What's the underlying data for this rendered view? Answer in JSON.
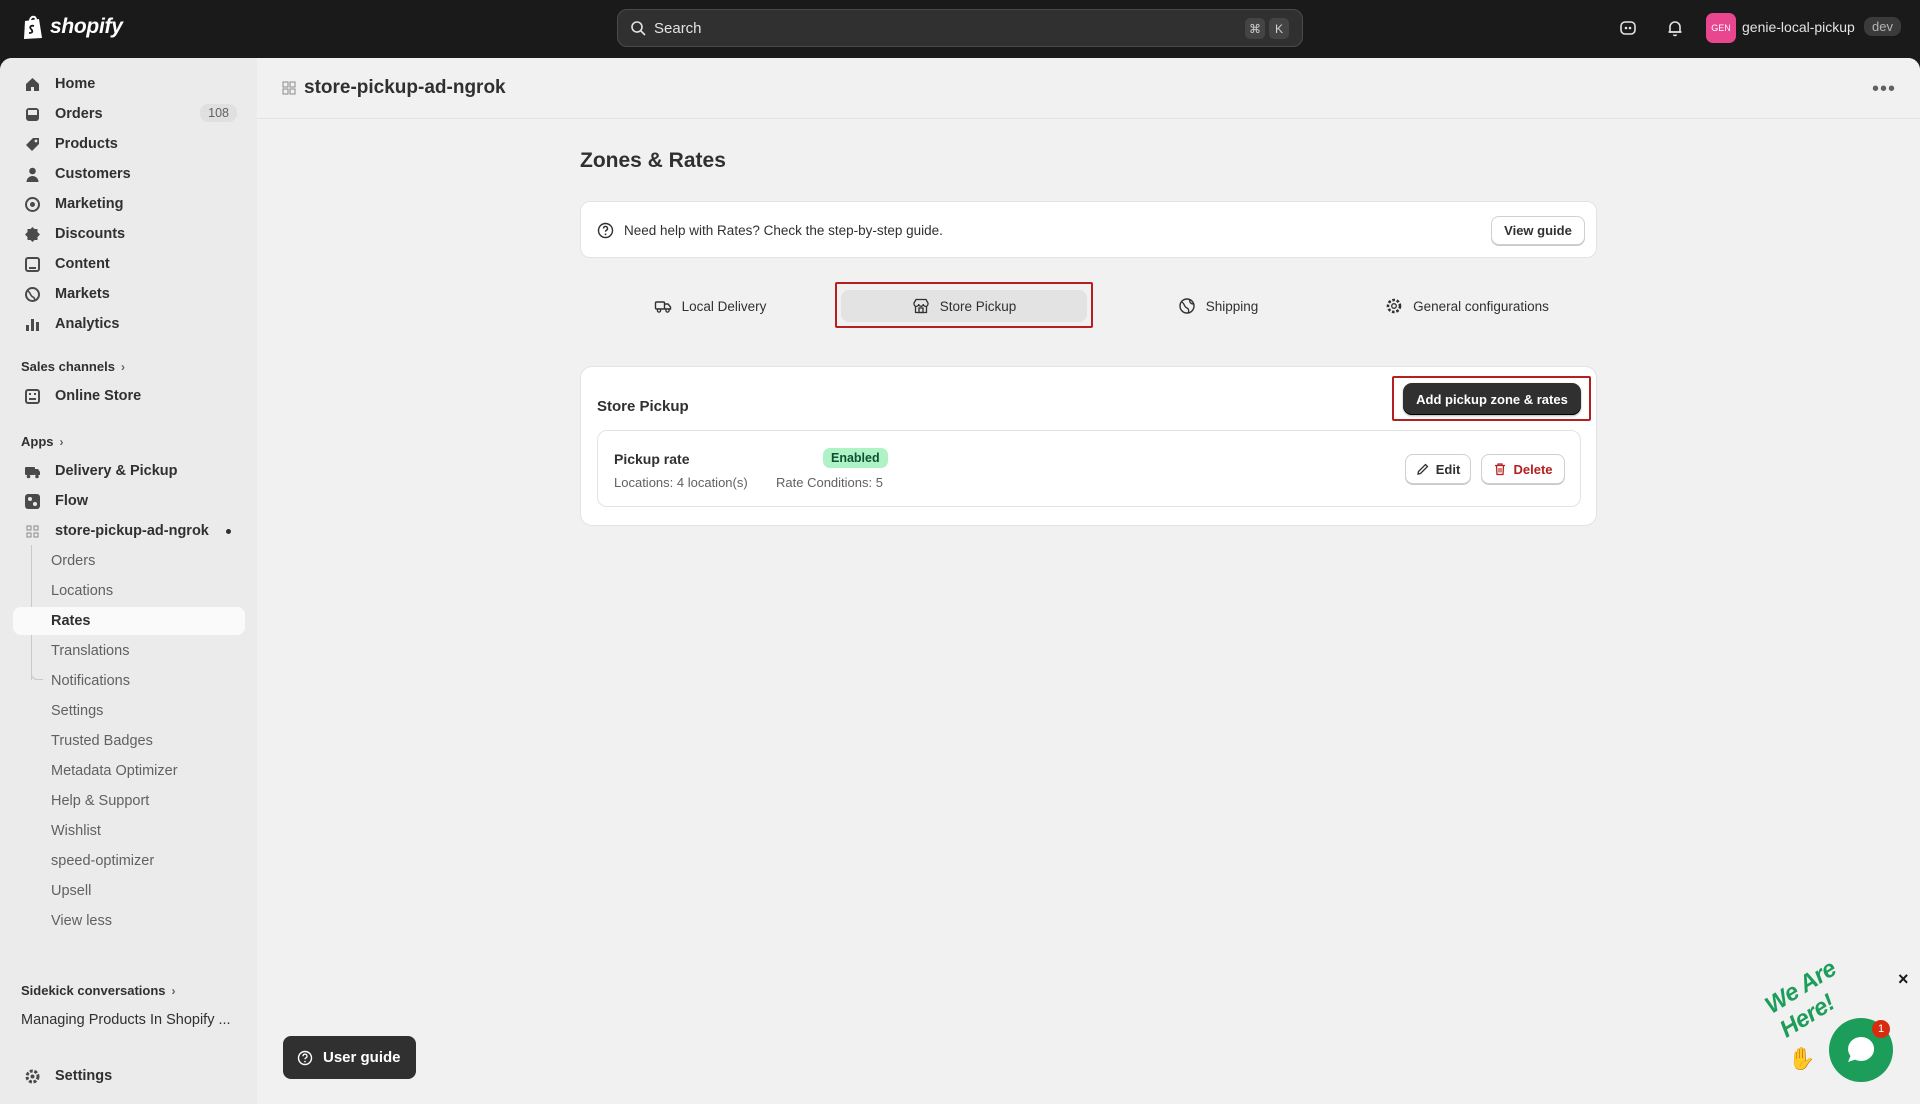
{
  "topbar": {
    "brand": "shopify",
    "search_placeholder": "Search",
    "shortcut_key1": "⌘",
    "shortcut_key2": "K",
    "store_initials": "GEN",
    "store_name": "genie-local-pickup",
    "store_tag": "dev"
  },
  "sidebar": {
    "main": [
      {
        "label": "Home"
      },
      {
        "label": "Orders",
        "count": "108"
      },
      {
        "label": "Products"
      },
      {
        "label": "Customers"
      },
      {
        "label": "Marketing"
      },
      {
        "label": "Discounts"
      },
      {
        "label": "Content"
      },
      {
        "label": "Markets"
      },
      {
        "label": "Analytics"
      }
    ],
    "sales_channels_heading": "Sales channels",
    "online_store": "Online Store",
    "apps_heading": "Apps",
    "apps": [
      "Delivery & Pickup",
      "Flow",
      "store-pickup-ad-ngrok"
    ],
    "app_sub": [
      "Orders",
      "Locations",
      "Rates",
      "Translations",
      "Notifications",
      "Settings",
      "Trusted Badges",
      "Metadata Optimizer",
      "Help & Support",
      "Wishlist",
      "speed-optimizer",
      "Upsell",
      "View less"
    ],
    "sidekick_heading": "Sidekick conversations",
    "sidekick_item": "Managing Products In Shopify ...",
    "settings": "Settings"
  },
  "page": {
    "app_title": "store-pickup-ad-ngrok",
    "heading": "Zones & Rates",
    "help_text": "Need help with Rates? Check the step-by-step guide.",
    "view_guide": "View guide",
    "tabs": [
      "Local Delivery",
      "Store Pickup",
      "Shipping",
      "General configurations"
    ],
    "selected_tab": "Store Pickup"
  },
  "store_pickup": {
    "title": "Store Pickup",
    "add_button": "Add pickup zone & rates",
    "rate": {
      "name": "Pickup rate",
      "status": "Enabled",
      "locations": "Locations: 4 location(s)",
      "conditions": "Rate Conditions: 5",
      "edit": "Edit",
      "delete": "Delete"
    }
  },
  "floating": {
    "user_guide": "User guide",
    "chat_text": "We Are Here!",
    "chat_count": "1",
    "chat_close": "×"
  },
  "colors": {
    "topbar": "#1a1a1a",
    "highlight": "#b3201f",
    "enabled_badge": "#aff2c6",
    "chat_green": "#1c9e5a"
  }
}
